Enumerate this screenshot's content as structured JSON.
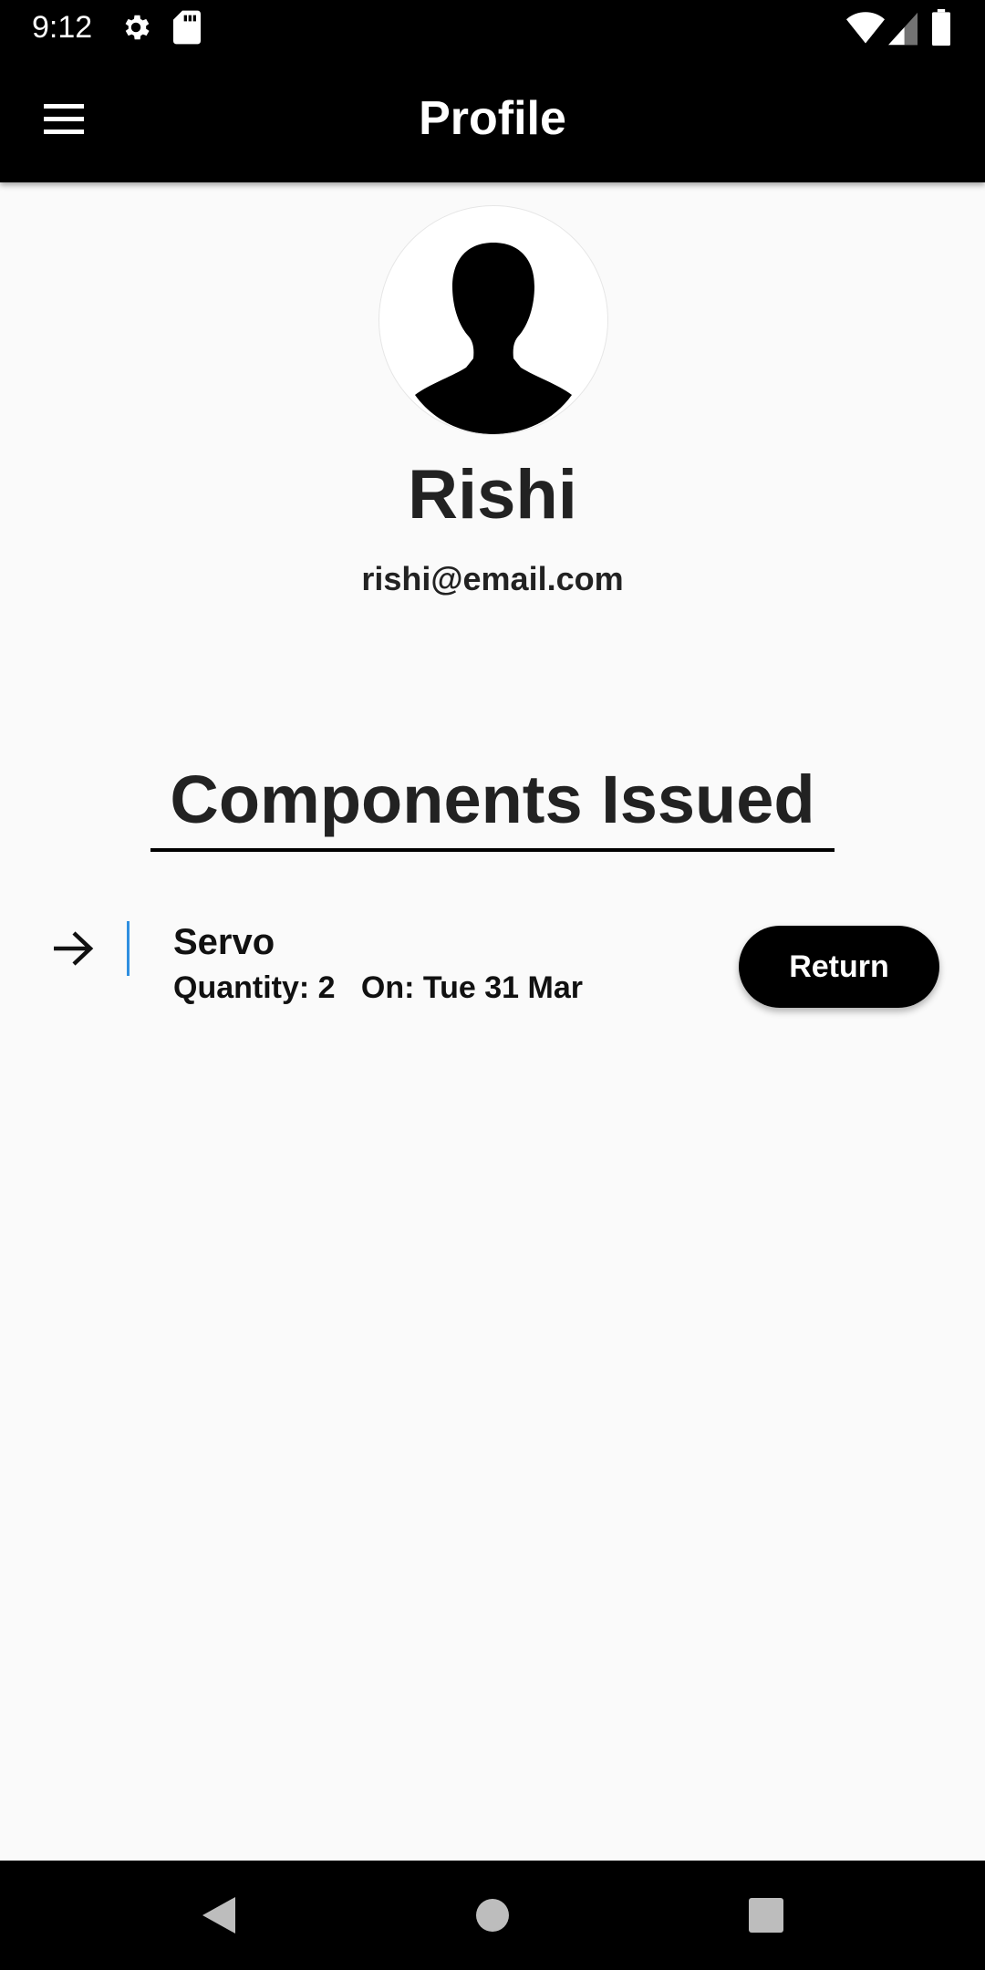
{
  "status_bar": {
    "time": "9:12",
    "icons": [
      "gear-icon",
      "sd-card-icon",
      "wifi-icon",
      "signal-icon",
      "battery-icon"
    ]
  },
  "app_bar": {
    "title": "Profile",
    "menu_icon": "hamburger-menu-icon"
  },
  "profile": {
    "avatar_icon": "person-silhouette-icon",
    "name": "Rishi",
    "email": "rishi@email.com"
  },
  "components_section": {
    "title": "Components Issued",
    "items": [
      {
        "icon": "arrow-right-icon",
        "name": "Servo",
        "meta": "Quantity: 2   On: Tue 31 Mar",
        "action_label": "Return"
      }
    ]
  },
  "nav_bar": {
    "buttons": [
      "back-icon",
      "home-icon",
      "recents-icon"
    ]
  },
  "colors": {
    "bar_background": "#000000",
    "page_background": "#fafafa",
    "divider_accent": "#2f8fe0",
    "text_primary": "#222222"
  }
}
